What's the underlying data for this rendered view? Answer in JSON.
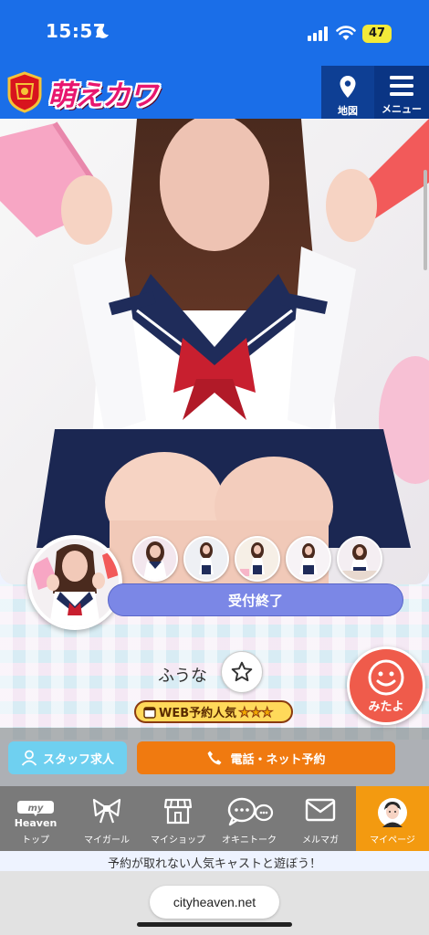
{
  "status_bar": {
    "time": "15:57",
    "battery": "47"
  },
  "header": {
    "logo_text": "萌えカワ",
    "map_label": "地図",
    "menu_label": "メニュー"
  },
  "profile": {
    "reception_status": "受付終了",
    "cast_name": "ふうな",
    "web_badge": "WEB予約人気",
    "web_badge_stars": "★★★",
    "mitayo_label": "みたよ",
    "thumbnail_count": 5
  },
  "actions": {
    "staff_recruit": "スタッフ求人",
    "phone_reserve": "電話・ネット予約"
  },
  "tabs": [
    {
      "label": "トップ",
      "icon": "my-heaven-icon",
      "icon_text_top": "my",
      "icon_text_bottom": "Heaven"
    },
    {
      "label": "マイガール",
      "icon": "ribbon-icon"
    },
    {
      "label": "マイショップ",
      "icon": "shop-icon"
    },
    {
      "label": "オキニトーク",
      "icon": "chat-icon"
    },
    {
      "label": "メルマガ",
      "icon": "mail-icon"
    },
    {
      "label": "マイページ",
      "icon": "user-avatar-icon"
    }
  ],
  "promo_text": "予約が取れない人気キャストと遊ぼう！",
  "browser": {
    "url": "cityheaven.net"
  },
  "colors": {
    "header_blue": "#1a6ee8",
    "header_button_navy": "#0e3f94",
    "status_pill": "#7b87e6",
    "reserve_orange": "#f07a10",
    "staff_cyan": "#6fd0f0",
    "mitayo_red": "#ef5b4b",
    "active_tab": "#f39a10"
  }
}
